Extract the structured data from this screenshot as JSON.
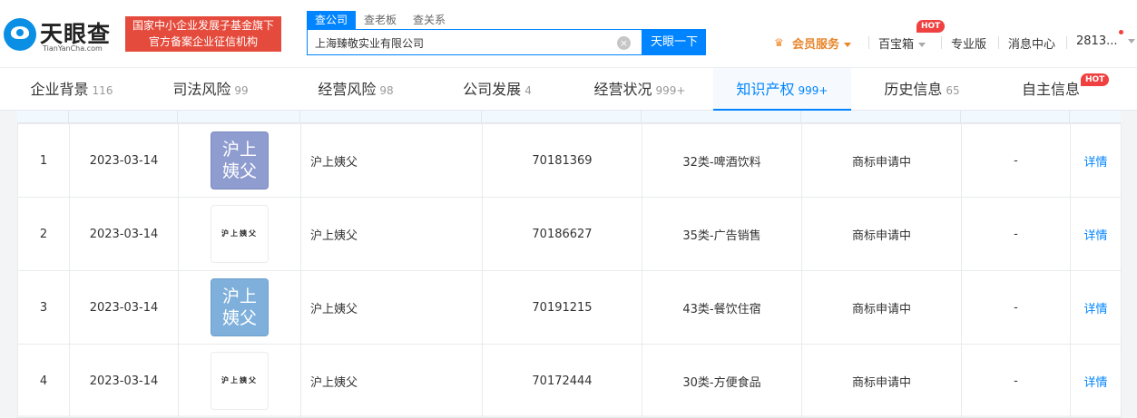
{
  "header": {
    "logo_name": "天眼查",
    "logo_sub": "TianYanCha.com",
    "gov_badge_line1": "国家中小企业发展子基金旗下",
    "gov_badge_line2": "官方备案企业征信机构",
    "search_tabs": [
      "查公司",
      "查老板",
      "查关系"
    ],
    "search_value": "上海臻敬实业有限公司",
    "search_button": "天眼一下",
    "vip_label": "会员服务",
    "baibaoxiang_label": "百宝箱",
    "pro_label": "专业版",
    "message_label": "消息中心",
    "user_label": "2813...",
    "hot_label": "HOT",
    "clear_glyph": "×",
    "vip_glyph": "♛"
  },
  "category_tabs": [
    {
      "label": "企业背景",
      "count": "116"
    },
    {
      "label": "司法风险",
      "count": "99"
    },
    {
      "label": "经营风险",
      "count": "98"
    },
    {
      "label": "公司发展",
      "count": "4"
    },
    {
      "label": "经营状况",
      "count": "999+"
    },
    {
      "label": "知识产权",
      "count": "999+"
    },
    {
      "label": "历史信息",
      "count": "65"
    },
    {
      "label": "自主信息",
      "count": ""
    }
  ],
  "trademarks": [
    {
      "index": "1",
      "date": "2023-03-14",
      "image_text": "沪上姨父",
      "name": "沪上姨父",
      "reg_no": "70181369",
      "category": "32类-啤酒饮料",
      "status": "商标申请中",
      "agent": "-",
      "action": "详情"
    },
    {
      "index": "2",
      "date": "2023-03-14",
      "image_text": "沪上姨父",
      "name": "沪上姨父",
      "reg_no": "70186627",
      "category": "35类-广告销售",
      "status": "商标申请中",
      "agent": "-",
      "action": "详情"
    },
    {
      "index": "3",
      "date": "2023-03-14",
      "image_text": "沪上姨父",
      "name": "沪上姨父",
      "reg_no": "70191215",
      "category": "43类-餐饮住宿",
      "status": "商标申请中",
      "agent": "-",
      "action": "详情"
    },
    {
      "index": "4",
      "date": "2023-03-14",
      "image_text": "沪上姨父",
      "name": "沪上姨父",
      "reg_no": "70172444",
      "category": "30类-方便食品",
      "status": "商标申请中",
      "agent": "-",
      "action": "详情"
    }
  ],
  "colors": {
    "accent": "#0084ff",
    "badge_red": "#e54b3c",
    "vip_orange": "#e8862b",
    "tm_purple": "#8f9ccf",
    "tm_blue": "#7fb0db"
  }
}
